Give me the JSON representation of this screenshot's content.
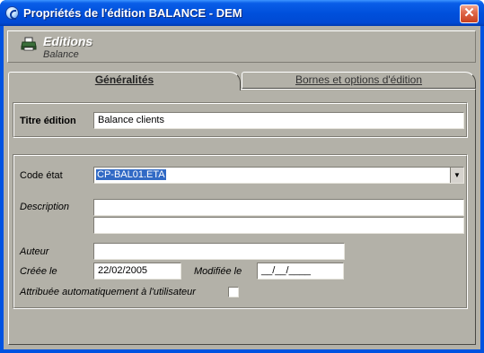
{
  "window": {
    "title": "Propriétés de l'édition BALANCE - DEM",
    "close_label": "✕"
  },
  "header": {
    "title": "Editions",
    "subtitle": "Balance",
    "icon": "printer-icon"
  },
  "tabs": [
    {
      "label": "Généralités",
      "active": true
    },
    {
      "label": "Bornes et options d'édition",
      "active": false
    }
  ],
  "general": {
    "titre_label": "Titre édition",
    "titre_value": "Balance clients",
    "code_label": "Code état",
    "code_value": "CP-BAL01.ETA",
    "code_dropdown_glyph": "▼",
    "description_label": "Description",
    "description_line1": "",
    "description_line2": "",
    "auteur_label": "Auteur",
    "auteur_value": "",
    "creee_label": "Créée le",
    "creee_value": "22/02/2005",
    "modifiee_label": "Modifiée le",
    "modifiee_value": "__/__/____",
    "auto_label": "Attribuée automatiquement à l'utilisateur",
    "auto_checked": false
  },
  "colors": {
    "titlebar": "#0050dc",
    "dialog_bg": "#b3b1a8",
    "selection": "#316ac5",
    "close_button": "#e06a4c"
  }
}
